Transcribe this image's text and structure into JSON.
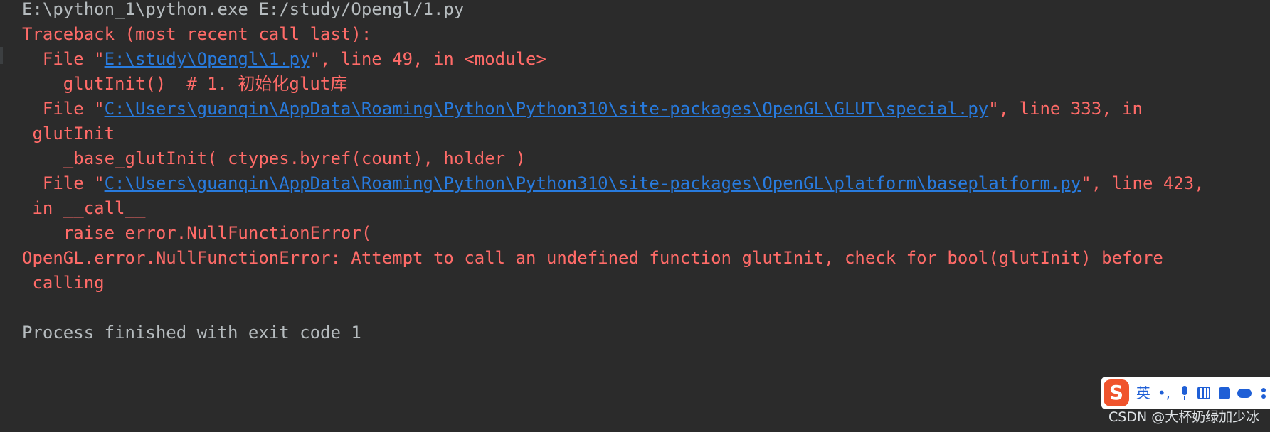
{
  "console": {
    "command": "E:\\python_1\\python.exe E:/study/Opengl/1.py",
    "traceback_header": "Traceback (most recent call last):",
    "frame1": {
      "prefix": "  File \"",
      "path": "E:\\study\\Opengl\\1.py",
      "suffix": "\", line 49, in <module>",
      "code": "    glutInit()  # 1. 初始化glut库"
    },
    "frame2": {
      "prefix": "  File \"",
      "path": "C:\\Users\\guanqin\\AppData\\Roaming\\Python\\Python310\\site-packages\\OpenGL\\GLUT\\special.py",
      "suffix": "\", line 333, in",
      "continuation": " glutInit",
      "code": "    _base_glutInit( ctypes.byref(count), holder )"
    },
    "frame3": {
      "prefix": "  File \"",
      "path": "C:\\Users\\guanqin\\AppData\\Roaming\\Python\\Python310\\site-packages\\OpenGL\\platform\\baseplatform.py",
      "suffix": "\", line 423,",
      "continuation": " in __call__",
      "code": "    raise error.NullFunctionError("
    },
    "error_message": "OpenGL.error.NullFunctionError: Attempt to call an undefined function glutInit, check for bool(glutInit) before",
    "error_continuation": " calling",
    "exit_message": "Process finished with exit code 1"
  },
  "ime_toolbar": {
    "logo": "S",
    "mode_label": "英",
    "punct_label": "•,",
    "icons": [
      "microphone-icon",
      "keyboard-icon",
      "skin-shirt-icon",
      "gamepad-icon",
      "more-icon"
    ],
    "accent_color": "#1f5fd6",
    "logo_color": "#f0542d"
  },
  "watermark": {
    "text": "CSDN @大杯奶绿加少冰"
  }
}
